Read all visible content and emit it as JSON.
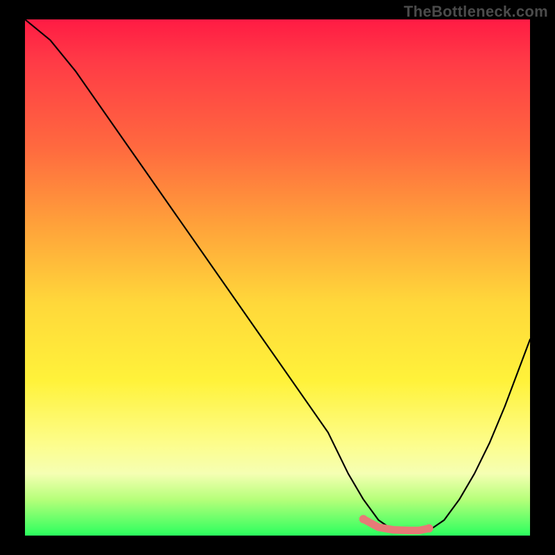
{
  "watermark": "TheBottleneck.com",
  "chart_data": {
    "type": "line",
    "title": "",
    "xlabel": "",
    "ylabel": "",
    "xlim": [
      0,
      100
    ],
    "ylim": [
      0,
      100
    ],
    "series": [
      {
        "name": "bottleneck-curve",
        "x": [
          0,
          5,
          10,
          15,
          20,
          25,
          30,
          35,
          40,
          45,
          50,
          55,
          60,
          64,
          67,
          70,
          73,
          76,
          78,
          80,
          83,
          86,
          89,
          92,
          95,
          100
        ],
        "y": [
          100,
          96,
          90,
          83,
          76,
          69,
          62,
          55,
          48,
          41,
          34,
          27,
          20,
          12,
          7,
          3,
          1,
          0.5,
          0.5,
          1,
          3,
          7,
          12,
          18,
          25,
          38
        ]
      }
    ],
    "highlight": {
      "name": "min-band",
      "x": [
        67,
        70,
        73,
        76,
        78,
        80
      ],
      "y": [
        3.2,
        1.6,
        1.1,
        1.0,
        1.0,
        1.4
      ],
      "color": "#e77a77"
    },
    "gradient_stops": [
      {
        "pos": 0,
        "color": "#ff1b44"
      },
      {
        "pos": 8,
        "color": "#ff3a46"
      },
      {
        "pos": 25,
        "color": "#ff6a3f"
      },
      {
        "pos": 40,
        "color": "#ffa23a"
      },
      {
        "pos": 55,
        "color": "#ffd83a"
      },
      {
        "pos": 70,
        "color": "#fff23a"
      },
      {
        "pos": 82,
        "color": "#fdfd8a"
      },
      {
        "pos": 88,
        "color": "#f5ffb3"
      },
      {
        "pos": 93,
        "color": "#b6ff7a"
      },
      {
        "pos": 100,
        "color": "#2bff5e"
      }
    ]
  }
}
